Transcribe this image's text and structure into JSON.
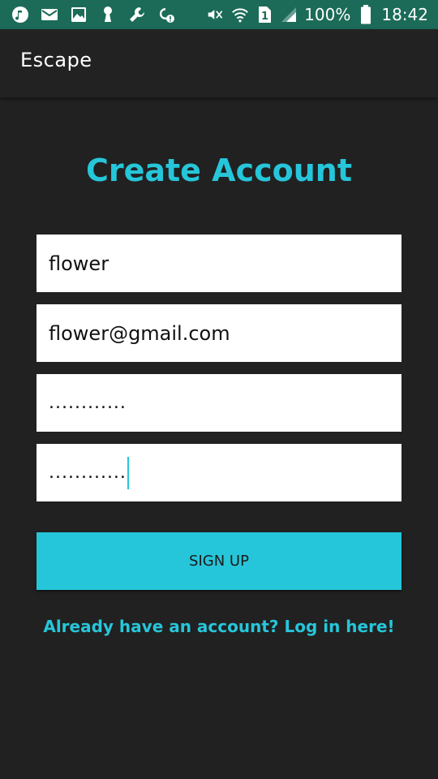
{
  "status_bar": {
    "battery_percent": "100%",
    "time": "18:42",
    "sim_slot": "1",
    "left_icons": [
      "music-icon",
      "mail-icon",
      "image-icon",
      "keyhole-icon",
      "wrench-icon",
      "sync-alert-icon"
    ],
    "right_icons": [
      "mute-icon",
      "wifi-icon",
      "sim-icon",
      "signal-icon",
      "battery-icon"
    ],
    "background": "#1b6b58"
  },
  "app_bar": {
    "title": "Escape"
  },
  "form": {
    "heading": "Create Account",
    "username_value": "flower",
    "email_value": "flower@gmail.com",
    "password_value": "............",
    "confirm_password_value": "............",
    "signup_label": "SIGN UP",
    "login_link": "Already have an account? Log in here!"
  },
  "colors": {
    "accent": "#26c6da",
    "background": "#212121",
    "field_background": "#ffffff"
  }
}
